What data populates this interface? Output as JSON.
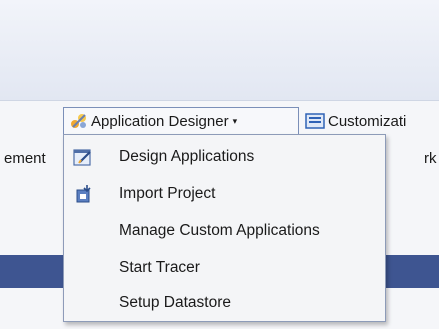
{
  "toolbar": {
    "app_designer_label": "Application Designer",
    "dropdown_arrow": "▾",
    "customization_label": "Customizati",
    "left_fragment": "ement",
    "right_fragment": "rk"
  },
  "menu": {
    "items": [
      {
        "label": "Design Applications",
        "icon": "design-applications-icon"
      },
      {
        "label": "Import Project",
        "icon": "import-project-icon"
      },
      {
        "label": "Manage Custom Applications",
        "icon": ""
      },
      {
        "label": "Start Tracer",
        "icon": ""
      },
      {
        "label": "Setup Datastore",
        "icon": ""
      }
    ]
  },
  "colors": {
    "header_bar": "#3e5591",
    "menu_border": "#8d9bb8"
  }
}
